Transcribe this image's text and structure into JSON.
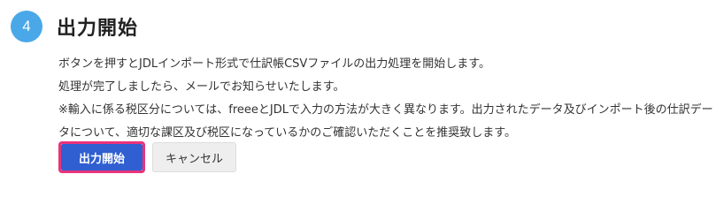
{
  "step": {
    "number": "4",
    "title": "出力開始"
  },
  "description": {
    "line1": "ボタンを押すとJDLインポート形式で仕訳帳CSVファイルの出力処理を開始します。",
    "line2": "処理が完了しましたら、メールでお知らせいたします。",
    "note": "※輸入に係る税区分については、freeeとJDLで入力の方法が大きく異なります。出力されたデータ及びインポート後の仕訳データについて、適切な課区及び税区になっているかのご確認いただくことを推奨致します。"
  },
  "actions": {
    "start_label": "出力開始",
    "cancel_label": "キャンセル"
  },
  "colors": {
    "badge": "#4aa8e8",
    "primary_button": "#2f5fd0",
    "highlight_border": "#e8337a"
  }
}
